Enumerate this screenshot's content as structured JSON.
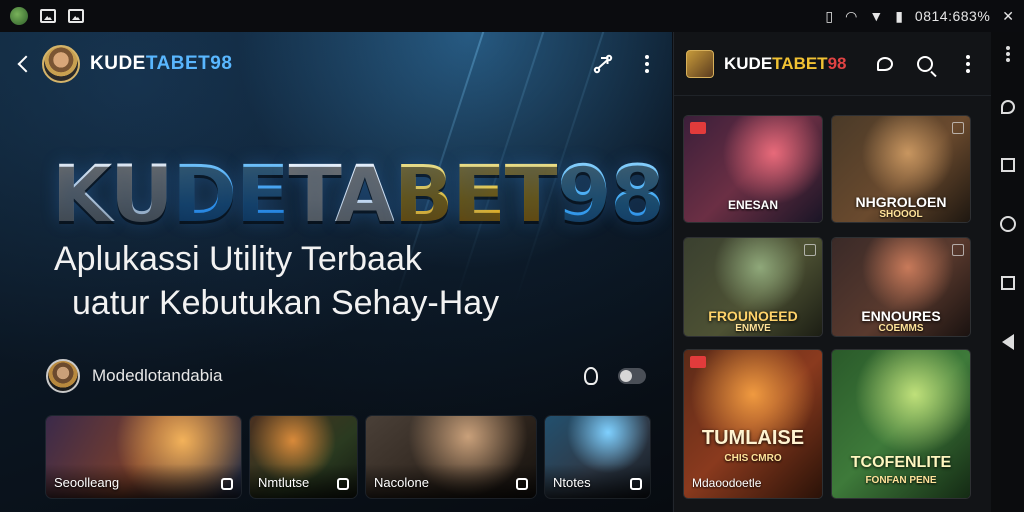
{
  "status_bar": {
    "time": "0814:683%",
    "icons": [
      "app-icon",
      "image-icon",
      "image-icon",
      "vibrate-icon",
      "wifi-icon",
      "signal-icon",
      "battery-icon",
      "close-icon"
    ]
  },
  "main": {
    "app_name_prefix": "KUDE",
    "app_name_suffix": "TABET98",
    "hero": {
      "logo_parts": [
        "KU",
        "DE",
        "TA",
        "BET",
        "98"
      ],
      "tagline_line1": "Aplukassi Utility Terbaak",
      "tagline_line2": "uatur Kebutukan Sehay-Hay"
    },
    "developer": {
      "name": "Modedlotandabia"
    },
    "cards": [
      {
        "label": "Seoolleang"
      },
      {
        "label": "Nmtlutse"
      },
      {
        "label": "Nacolone"
      },
      {
        "label": "Ntotes"
      }
    ]
  },
  "side": {
    "title_prefix": "KUDE",
    "title_mid": "TABET",
    "title_suffix": "98",
    "tiles": [
      {
        "label": "ENESAN",
        "sub": ""
      },
      {
        "label": "NHGROLOEN",
        "sub": "SHOOOL"
      },
      {
        "label": "FROUNOEED",
        "sub": "ENMVE"
      },
      {
        "label": "ENNOURES",
        "sub": "COEMMS"
      },
      {
        "label": "TUMLAISE",
        "sub": "CHIS CMRO"
      },
      {
        "label": "TCOFENLITE",
        "sub": "FONFAN PENE"
      }
    ],
    "tile_footer_labels": [
      "Mdaoodoetle"
    ]
  },
  "colors": {
    "accent_blue": "#59b7ff",
    "accent_gold": "#f1c233",
    "accent_red": "#e04343"
  }
}
